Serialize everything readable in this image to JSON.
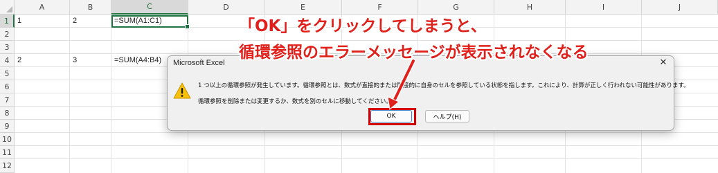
{
  "spreadsheet": {
    "columns": [
      "A",
      "B",
      "C",
      "D",
      "E",
      "F",
      "G",
      "H",
      "I",
      "J"
    ],
    "rows": [
      "1",
      "2",
      "3",
      "4",
      "5",
      "6",
      "7",
      "8",
      "9",
      "10",
      "11",
      "12"
    ],
    "selected_column": "C",
    "selected_row": "1",
    "cells": {
      "A1": "1",
      "B1": "2",
      "C1": "=SUM(A1:C1)",
      "A4": "2",
      "B4": "3",
      "C4": "=SUM(A4:B4)"
    }
  },
  "dialog": {
    "title": "Microsoft Excel",
    "close_glyph": "✕",
    "message_line1": "1 つ以上の循環参照が発生しています。循環参照とは、数式が直接的または間接的に自身のセルを参照している状態を指します。これにより、計算が正しく行われない可能性があります。",
    "message_line2": "循環参照を削除または変更するか、数式を別のセルに移動してください。",
    "ok_label": "OK",
    "help_label": "ヘルプ(H)",
    "icon": "warning-icon"
  },
  "annotation": {
    "line1": "「OK」をクリックしてしまうと、",
    "line2": "循環参照のエラーメッセージが表示されなくなる",
    "color": "#e0201b"
  }
}
